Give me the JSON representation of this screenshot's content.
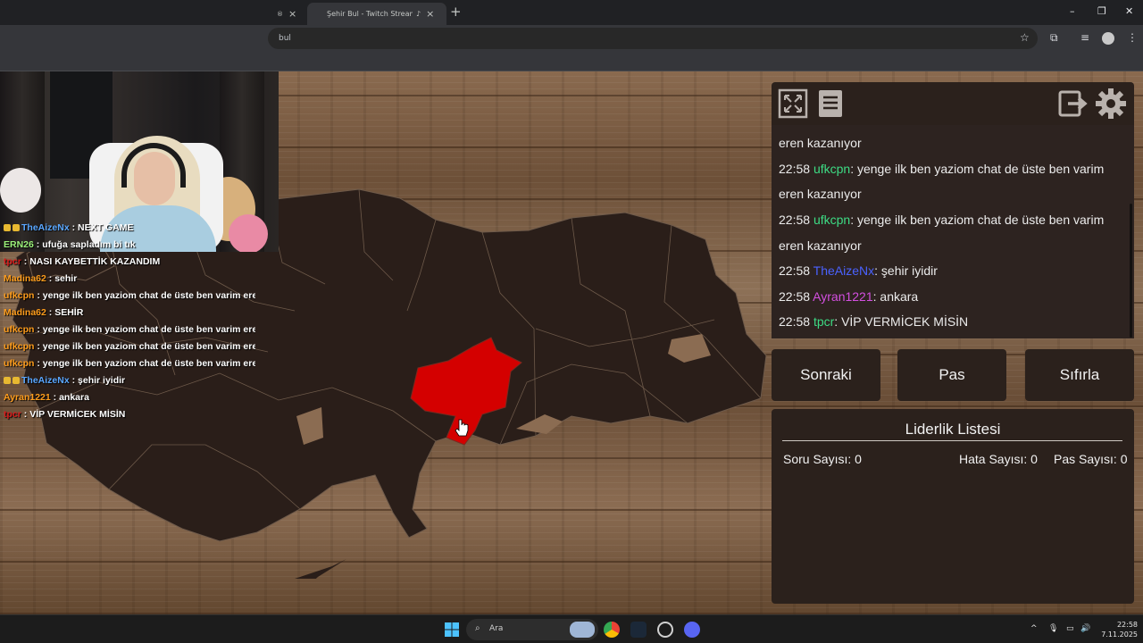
{
  "browser": {
    "tab_prev_close": "×",
    "tab_active_title": "Şehir Bul - Twitch Stream Ga",
    "tab_active_close": "×",
    "new_tab": "+",
    "address_text": "bul",
    "window_min": "–",
    "window_restore": "❐",
    "window_close": "✕"
  },
  "stream_chat_overlay": [
    {
      "user": "TheAizeNx",
      "color": "#5aa7ff",
      "badge": true,
      "message": "NEXT GAME"
    },
    {
      "user": "ERN26",
      "color": "#9cf27a",
      "badge": false,
      "message": "ufuğa sapladım bi tık"
    },
    {
      "user": "tpcr",
      "color": "#d71b1b",
      "badge": false,
      "message": "NASI KAYBETTİK KAZANDIM"
    },
    {
      "user": "Madina62",
      "color": "#ff9d1c",
      "badge": false,
      "message": "sehir"
    },
    {
      "user": "ufkcpn",
      "color": "#ff9d1c",
      "badge": false,
      "message": "yenge ilk ben yaziom chat de üste ben varim eren ka"
    },
    {
      "user": "Madina62",
      "color": "#ff9d1c",
      "badge": false,
      "message": "SEHİR"
    },
    {
      "user": "ufkcpn",
      "color": "#ff9d1c",
      "badge": false,
      "message": "yenge ilk ben yaziom chat de üste ben varim eren ka"
    },
    {
      "user": "ufkcpn",
      "color": "#ff9d1c",
      "badge": false,
      "message": "yenge ilk ben yaziom chat de üste ben varim eren ka"
    },
    {
      "user": "ufkcpn",
      "color": "#ff9d1c",
      "badge": false,
      "message": "yenge ilk ben yaziom chat de üste ben varim eren ka"
    },
    {
      "user": "TheAizeNx",
      "color": "#5aa7ff",
      "badge": true,
      "message": "şehir iyidir"
    },
    {
      "user": "Ayran1221",
      "color": "#ff9d1c",
      "badge": false,
      "message": "ankara"
    },
    {
      "user": "tpcr",
      "color": "#d71b1b",
      "badge": false,
      "message": "VİP VERMİCEK MİSİN"
    }
  ],
  "game": {
    "toolbar_icons": [
      "fullscreen-icon",
      "notes-icon",
      "logout-icon",
      "settings-icon"
    ],
    "chat_partial": "eren kazanıyor",
    "chat": [
      {
        "time": "22:58",
        "user": "ufkcpn",
        "color": "#3ddc84",
        "message": "yenge ilk ben yaziom chat de üste ben varim eren kazanıyor"
      },
      {
        "time": "22:58",
        "user": "ufkcpn",
        "color": "#3ddc84",
        "message": "yenge ilk ben yaziom chat de üste ben varim eren kazanıyor"
      },
      {
        "time": "22:58",
        "user": "TheAizeNx",
        "color": "#4a62ff",
        "message": "şehir iyidir"
      },
      {
        "time": "22:58",
        "user": "Ayran1221",
        "color": "#d34fe0",
        "message": "ankara"
      },
      {
        "time": "22:58",
        "user": "tpcr",
        "color": "#3ddc84",
        "message": "VİP VERMİCEK MİSİN"
      }
    ],
    "buttons": {
      "next": "Sonraki",
      "pass": "Pas",
      "reset": "Sıfırla"
    },
    "leaderboard": {
      "title": "Liderlik Listesi",
      "question_count": "Soru Sayısı: 0",
      "error_count": "Hata Sayısı: 0",
      "pass_count": "Pas Sayısı: 0"
    },
    "highlight_color": "#d40000",
    "map_color": "#2a1e19"
  },
  "taskbar": {
    "search_placeholder": "Ara",
    "time": "22:58",
    "date": "7.11.2025",
    "tray_up": "^"
  }
}
